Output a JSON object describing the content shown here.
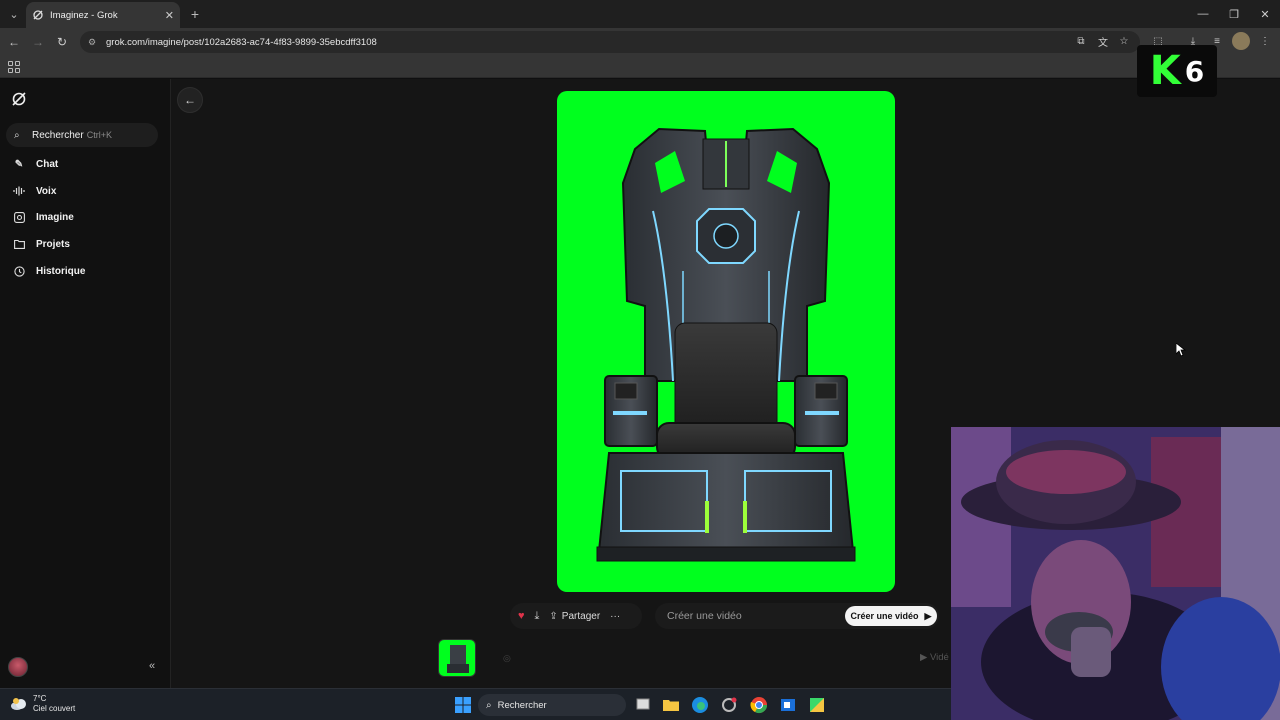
{
  "browser": {
    "tab_title": "Imaginez - Grok",
    "url": "grok.com/imagine/post/102a2683-ac74-4f83-9899-35ebcdff3108"
  },
  "sidebar": {
    "search_label": "Rechercher",
    "search_shortcut": "Ctrl+K",
    "items": [
      {
        "label": "Chat",
        "icon": "edit-icon"
      },
      {
        "label": "Voix",
        "icon": "voice-icon"
      },
      {
        "label": "Imagine",
        "icon": "imagine-icon"
      },
      {
        "label": "Projets",
        "icon": "folder-icon"
      },
      {
        "label": "Historique",
        "icon": "history-icon"
      }
    ]
  },
  "main": {
    "image_subject": "sci-fi throne",
    "share_label": "Partager",
    "prompt_placeholder": "Créer une vidéo",
    "create_button_label": "Créer une vidéo",
    "video_hint": "Vidé"
  },
  "overlay": {
    "badge_letter": "K",
    "badge_number": "6"
  },
  "taskbar": {
    "temperature": "7°C",
    "weather": "Ciel couvert",
    "search_label": "Rechercher"
  },
  "colors": {
    "green_screen": "#00ff1e",
    "accent_heart": "#e0334a",
    "badge_green": "#32ff37"
  }
}
